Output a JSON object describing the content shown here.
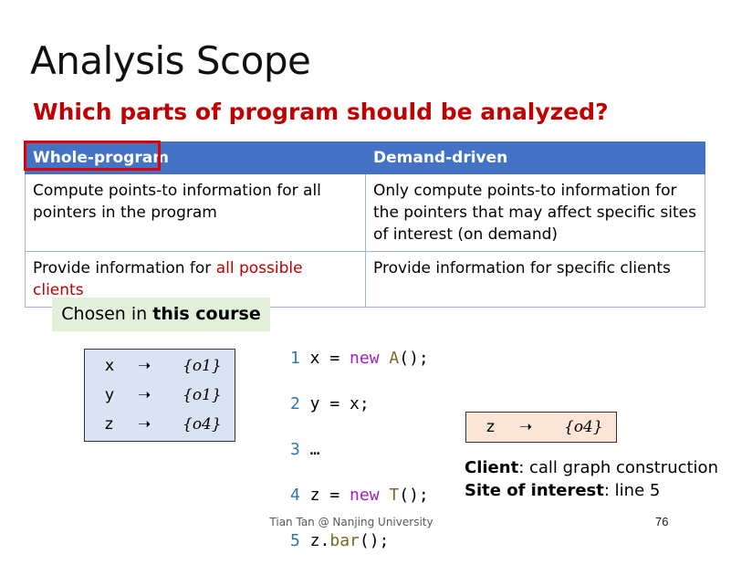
{
  "slide": {
    "title": "Analysis Scope",
    "subtitle": "Which parts of program should be analyzed?"
  },
  "table": {
    "headers": [
      "Whole-program",
      "Demand-driven"
    ],
    "rows": [
      {
        "left": "Compute points-to information for all pointers in the program",
        "right": "Only compute points-to information for the pointers that may affect specific sites of interest (on demand)"
      },
      {
        "left_prefix": "Provide information for ",
        "left_highlight": "all possible clients",
        "right": "Provide information for specific clients"
      }
    ]
  },
  "chosen": {
    "prefix": "Chosen in ",
    "bold": "this course"
  },
  "points_to": [
    {
      "var": "x",
      "arrow": "➝",
      "set": "{o1}"
    },
    {
      "var": "y",
      "arrow": "➝",
      "set": "{o1}"
    },
    {
      "var": "z",
      "arrow": "➝",
      "set": "{o4}"
    }
  ],
  "code": [
    {
      "n": "1",
      "pre": " x = ",
      "kw": "new",
      "ty": " A",
      "post": "();"
    },
    {
      "n": "2",
      "pre": " y = x;",
      "kw": "",
      "ty": "",
      "post": ""
    },
    {
      "n": "3",
      "pre": " …",
      "kw": "",
      "ty": "",
      "post": ""
    },
    {
      "n": "4",
      "pre": " z = ",
      "kw": "new",
      "ty": " T",
      "post": "();"
    },
    {
      "n": "5",
      "pre": " z.",
      "kw": "",
      "ty": "bar",
      "post": "();"
    }
  ],
  "client_box": {
    "var": "z",
    "arrow": "➝",
    "set": "{o4}"
  },
  "info": {
    "client_label": "Client",
    "client_value": ": call graph construction",
    "site_label": "Site of interest",
    "site_value": ": line 5"
  },
  "footer": "Tian Tan @ Nanjing University",
  "page_number": "76"
}
